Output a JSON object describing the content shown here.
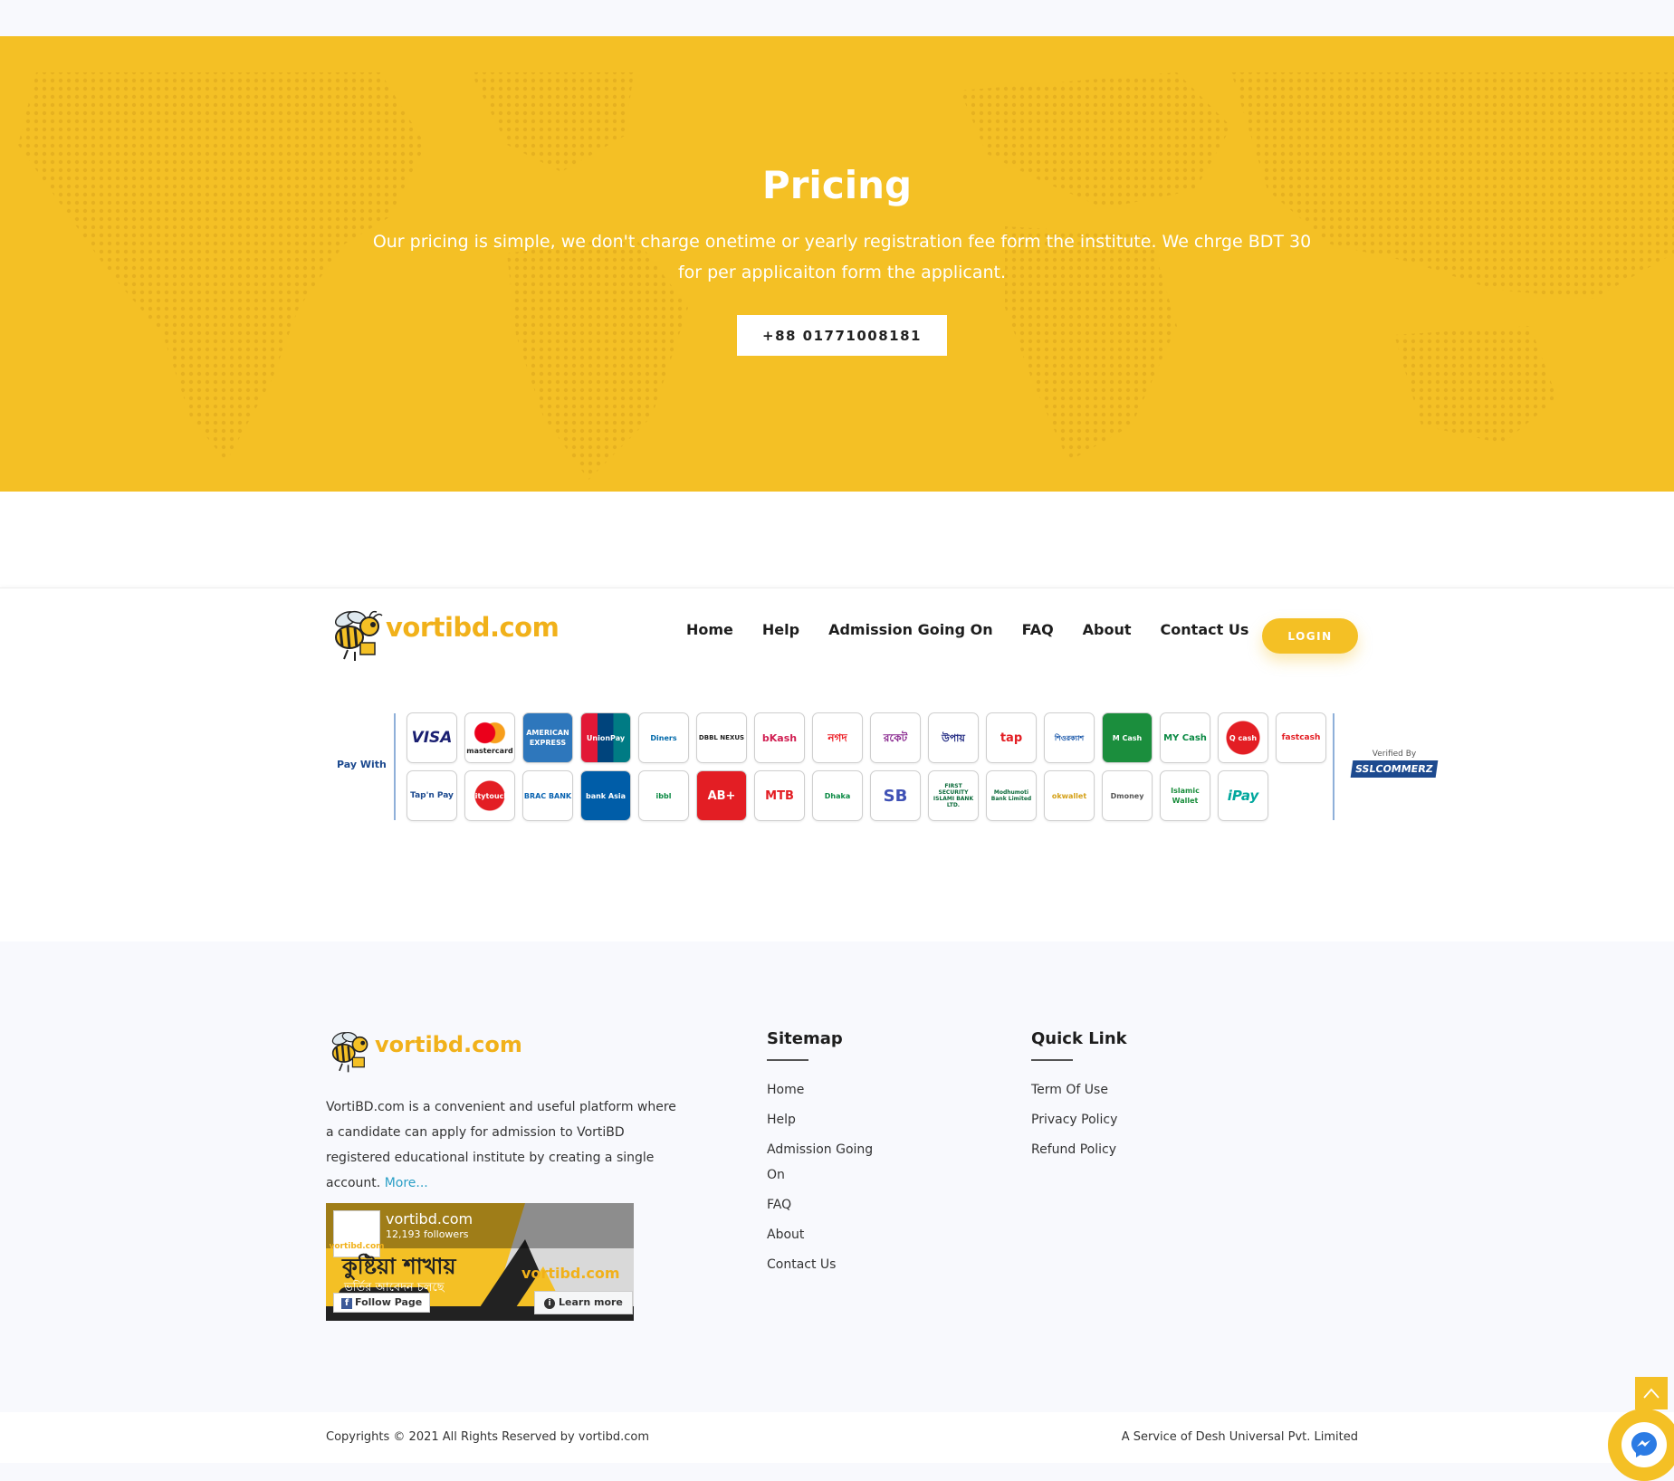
{
  "hero": {
    "title": "Pricing",
    "text": "Our pricing is simple, we don't charge onetime or yearly registration fee form the institute. We chrge BDT 30 for per applicaiton form the applicant.",
    "phone_button": "+88 01771008181",
    "background_color": "#f4c025"
  },
  "navbar": {
    "brand": "vortibd.com",
    "links": [
      "Home",
      "Help",
      "Admission Going On",
      "FAQ",
      "About",
      "Contact Us"
    ],
    "login_label": "LOGIN"
  },
  "payment": {
    "pay_with_label": "Pay With",
    "row1": [
      "VISA",
      "mastercard",
      "AMERICAN EXPRESS",
      "UnionPay",
      "Diners",
      "DBBL NEXUS",
      "bKash",
      "নগদ",
      "রকেট",
      "উপায়",
      "tap",
      "শিওরক্যাশ",
      "M Cash",
      "MY Cash",
      "Q cash",
      "fastcash"
    ],
    "row2": [
      "Tap'n Pay",
      "citytouch",
      "BRAC BANK",
      "bank Asia",
      "ibbl",
      "AB+",
      "MTB",
      "Dhaka",
      "SB",
      "FIRST SECURITY ISLAMI BANK LTD.",
      "Modhumoti Bank Limited",
      "okwallet",
      "Dmoney",
      "Islamic Wallet",
      "iPay"
    ],
    "verified_by": "Verified By",
    "verifier": "SSLCOMMERZ"
  },
  "footer": {
    "brand": "vortibd.com",
    "about_text": "VortiBD.com is a convenient and useful platform where a candidate can apply for admission to VortiBD registered educational institute by creating a single account.",
    "more_link": "More...",
    "facebook": {
      "page_name": "vortibd.com",
      "followers": "12,193 followers",
      "follow_label": "Follow Page",
      "learn_more_label": "Learn more",
      "banner_text_bn": "কুষ্টিয়া শাখায়",
      "banner_sub_bn": "ভর্তির আবেদন চলছে",
      "banner_brand": "vortibd.com"
    },
    "sitemap": {
      "title": "Sitemap",
      "links": [
        "Home",
        "Help",
        "Admission Going On",
        "FAQ",
        "About",
        "Contact Us"
      ]
    },
    "quick_link": {
      "title": "Quick Link",
      "links": [
        "Term Of Use",
        "Privacy Policy",
        "Refund Policy"
      ]
    }
  },
  "bottom_bar": {
    "copyright": "Copyrights © 2021 All Rights Reserved by vortibd.com",
    "service": "A Service of Desh Universal Pvt. Limited"
  },
  "colors": {
    "accent": "#f4c025",
    "link": "#2a9fc6",
    "pay_blue": "#1d4a8f"
  }
}
